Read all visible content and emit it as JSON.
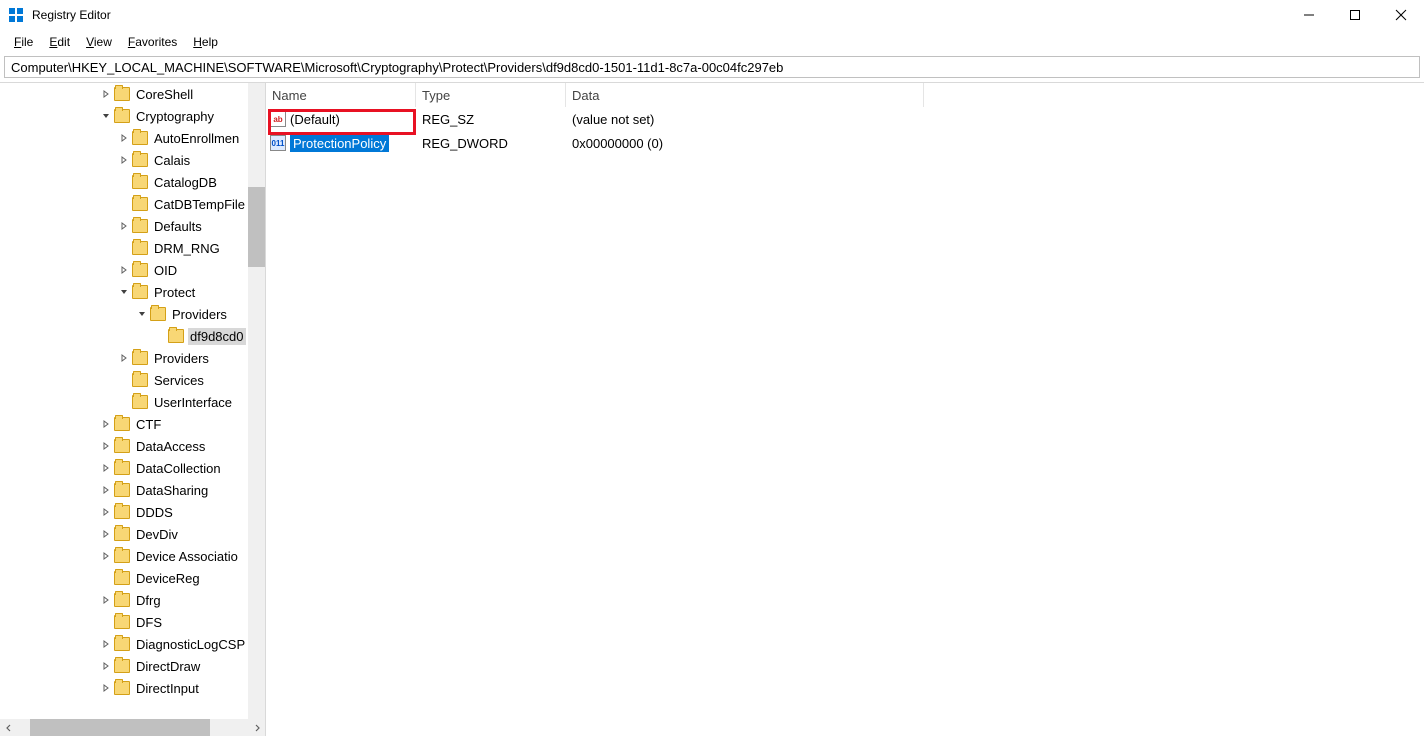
{
  "window": {
    "title": "Registry Editor"
  },
  "menu": {
    "file": "File",
    "edit": "Edit",
    "view": "View",
    "favorites": "Favorites",
    "help": "Help"
  },
  "address": "Computer\\HKEY_LOCAL_MACHINE\\SOFTWARE\\Microsoft\\Cryptography\\Protect\\Providers\\df9d8cd0-1501-11d1-8c7a-00c04fc297eb",
  "treeItems": [
    {
      "depth": 5,
      "arrow": "right",
      "label": "CoreShell",
      "selected": false
    },
    {
      "depth": 5,
      "arrow": "down",
      "label": "Cryptography",
      "selected": false
    },
    {
      "depth": 6,
      "arrow": "right",
      "label": "AutoEnrollmen",
      "selected": false
    },
    {
      "depth": 6,
      "arrow": "right",
      "label": "Calais",
      "selected": false
    },
    {
      "depth": 6,
      "arrow": "none",
      "label": "CatalogDB",
      "selected": false
    },
    {
      "depth": 6,
      "arrow": "none",
      "label": "CatDBTempFile",
      "selected": false
    },
    {
      "depth": 6,
      "arrow": "right",
      "label": "Defaults",
      "selected": false
    },
    {
      "depth": 6,
      "arrow": "none",
      "label": "DRM_RNG",
      "selected": false
    },
    {
      "depth": 6,
      "arrow": "right",
      "label": "OID",
      "selected": false
    },
    {
      "depth": 6,
      "arrow": "down",
      "label": "Protect",
      "selected": false
    },
    {
      "depth": 7,
      "arrow": "down",
      "label": "Providers",
      "selected": false
    },
    {
      "depth": 8,
      "arrow": "none",
      "label": "df9d8cd0",
      "selected": true
    },
    {
      "depth": 6,
      "arrow": "right",
      "label": "Providers",
      "selected": false
    },
    {
      "depth": 6,
      "arrow": "none",
      "label": "Services",
      "selected": false
    },
    {
      "depth": 6,
      "arrow": "none",
      "label": "UserInterface",
      "selected": false
    },
    {
      "depth": 5,
      "arrow": "right",
      "label": "CTF",
      "selected": false
    },
    {
      "depth": 5,
      "arrow": "right",
      "label": "DataAccess",
      "selected": false
    },
    {
      "depth": 5,
      "arrow": "right",
      "label": "DataCollection",
      "selected": false
    },
    {
      "depth": 5,
      "arrow": "right",
      "label": "DataSharing",
      "selected": false
    },
    {
      "depth": 5,
      "arrow": "right",
      "label": "DDDS",
      "selected": false
    },
    {
      "depth": 5,
      "arrow": "right",
      "label": "DevDiv",
      "selected": false
    },
    {
      "depth": 5,
      "arrow": "right",
      "label": "Device Associatio",
      "selected": false
    },
    {
      "depth": 5,
      "arrow": "none",
      "label": "DeviceReg",
      "selected": false
    },
    {
      "depth": 5,
      "arrow": "right",
      "label": "Dfrg",
      "selected": false
    },
    {
      "depth": 5,
      "arrow": "none",
      "label": "DFS",
      "selected": false
    },
    {
      "depth": 5,
      "arrow": "right",
      "label": "DiagnosticLogCSP",
      "selected": false
    },
    {
      "depth": 5,
      "arrow": "right",
      "label": "DirectDraw",
      "selected": false
    },
    {
      "depth": 5,
      "arrow": "right",
      "label": "DirectInput",
      "selected": false
    }
  ],
  "columns": {
    "name": "Name",
    "type": "Type",
    "data": "Data"
  },
  "values": [
    {
      "kind": "sz",
      "iconText": "ab",
      "name": "(Default)",
      "type": "REG_SZ",
      "data": "(value not set)",
      "selected": false
    },
    {
      "kind": "num",
      "iconText": "011",
      "name": "ProtectionPolicy",
      "type": "REG_DWORD",
      "data": "0x00000000 (0)",
      "selected": true
    }
  ]
}
